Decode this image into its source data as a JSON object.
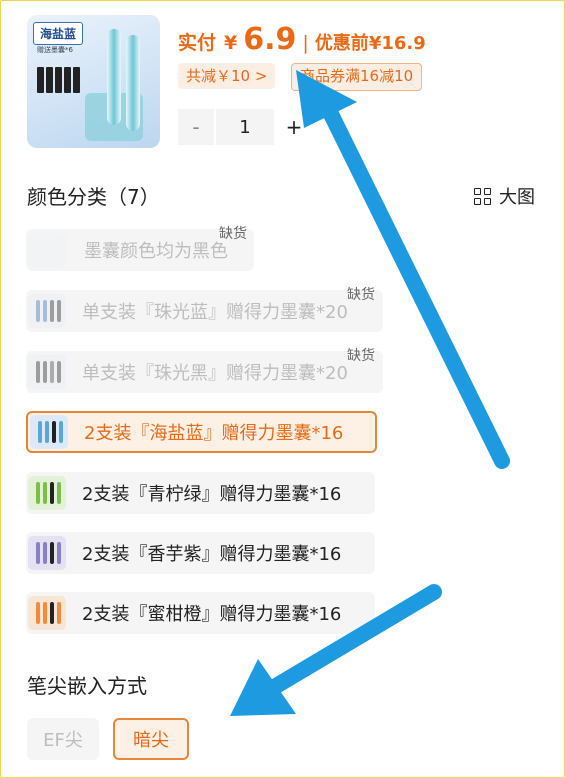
{
  "product": {
    "thumb_tag": "海盐蓝",
    "thumb_sub": "赠送墨囊*6",
    "price_label": "实付",
    "currency": "¥",
    "price": "6.9",
    "separator": "|",
    "original_label": "优惠前",
    "original_price": "¥16.9",
    "discount_chip": "共减￥10 >",
    "coupon_chip": "商品券满16减10",
    "quantity": "1",
    "minus": "-",
    "plus": "+"
  },
  "color_section": {
    "title": "颜色分类（7）",
    "big_view_label": "大图",
    "options": [
      {
        "label": "墨囊颜色均为黑色",
        "state": "disabled",
        "soldout": "缺货"
      },
      {
        "label": "单支装『珠光蓝』赠得力墨囊*20",
        "state": "disabled",
        "soldout": "缺货"
      },
      {
        "label": "单支装『珠光黑』赠得力墨囊*20",
        "state": "disabled",
        "soldout": "缺货"
      },
      {
        "label": "2支装『海盐蓝』赠得力墨囊*16",
        "state": "selected"
      },
      {
        "label": "2支装『青柠绿』赠得力墨囊*16",
        "state": "normal"
      },
      {
        "label": "2支装『香芋紫』赠得力墨囊*16",
        "state": "normal"
      },
      {
        "label": "2支装『蜜柑橙』赠得力墨囊*16",
        "state": "normal"
      }
    ]
  },
  "tip_section": {
    "title": "笔尖嵌入方式",
    "options": [
      {
        "label": "EF尖",
        "state": "disabled"
      },
      {
        "label": "暗尖",
        "state": "selected"
      }
    ]
  },
  "colors": {
    "accent": "#e96a16",
    "arrow": "#1e9be0",
    "selected_border": "#e6863a"
  }
}
